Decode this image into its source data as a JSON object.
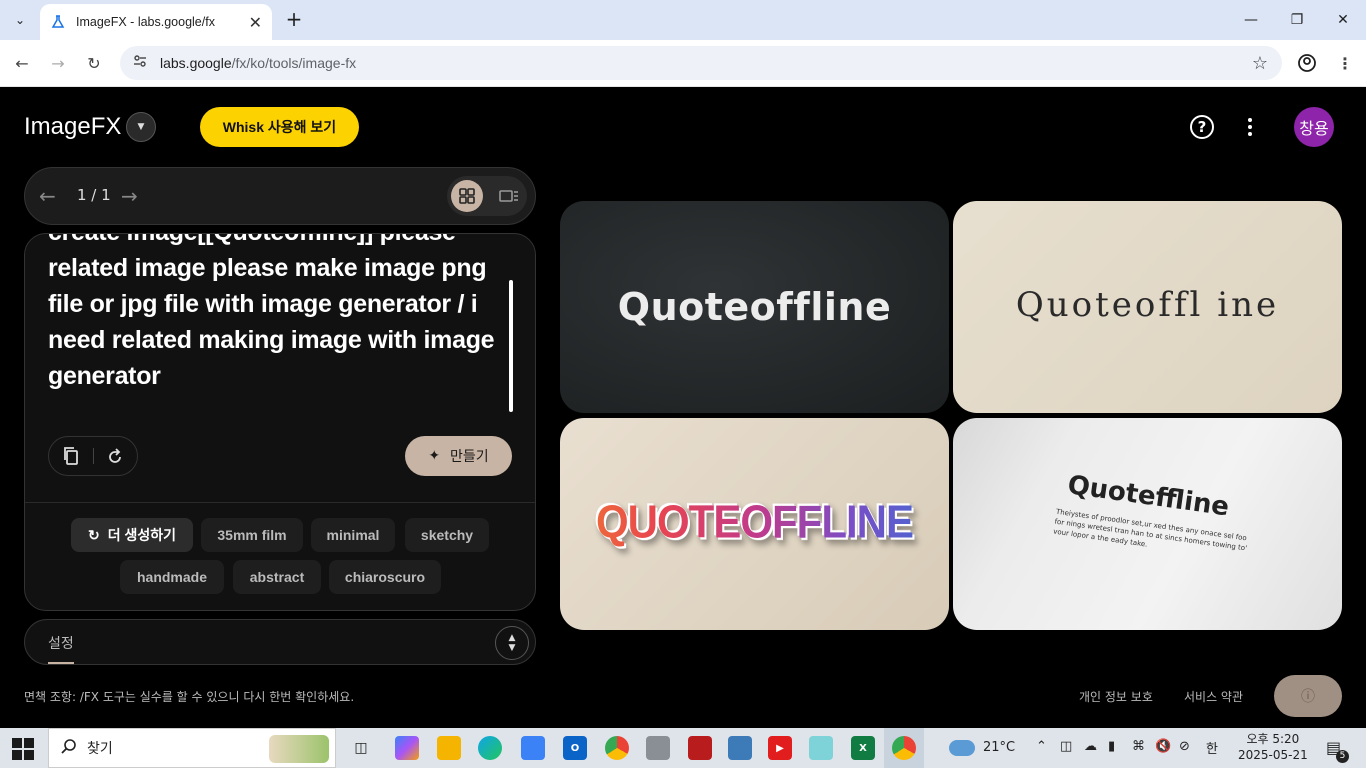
{
  "browser": {
    "tab_title": "ImageFX - labs.google/fx",
    "url_host": "labs.google",
    "url_path": "/fx/ko/tools/image-fx"
  },
  "header": {
    "logo": "ImageFX",
    "whisk_button": "Whisk 사용해 보기",
    "avatar_initials": "창용"
  },
  "pager": {
    "count": "1 / 1"
  },
  "prompt": {
    "text": "create image[[Quoteoffline]] please related image please make image png file or jpg file with image generator / i need related making image with image generator",
    "make_button": "만들기"
  },
  "suggestions": {
    "more_button": "더 생성하기",
    "chips": [
      "35mm film",
      "minimal",
      "sketchy",
      "handmade",
      "abstract",
      "chiaroscuro"
    ]
  },
  "settings": {
    "label": "설정"
  },
  "gallery": {
    "images": [
      {
        "text": "Quoteoffline"
      },
      {
        "text": "Quoteoffl ine"
      },
      {
        "text": "QUOTEOFFLINE"
      },
      {
        "text": "Quoteffline",
        "subtext": "Theiystes of proodlor set,ur xed thes any onace sel foo for nings wretesl tran han to at sincs homers towing to' vour lopor a the eady take."
      }
    ]
  },
  "footer": {
    "disclaimer": "면책 조항: /FX 도구는 실수를 할 수 있으니 다시 한번 확인하세요.",
    "privacy": "개인 정보 보호",
    "terms": "서비스 약관"
  },
  "taskbar": {
    "search_placeholder": "찾기",
    "weather": "21°C",
    "time": "오후 5:20",
    "date": "2025-05-21",
    "notification_count": "5"
  },
  "colors": {
    "accent_yellow": "#fcd200",
    "accent_beige": "#c8b4a4",
    "avatar_purple": "#8e24aa"
  }
}
